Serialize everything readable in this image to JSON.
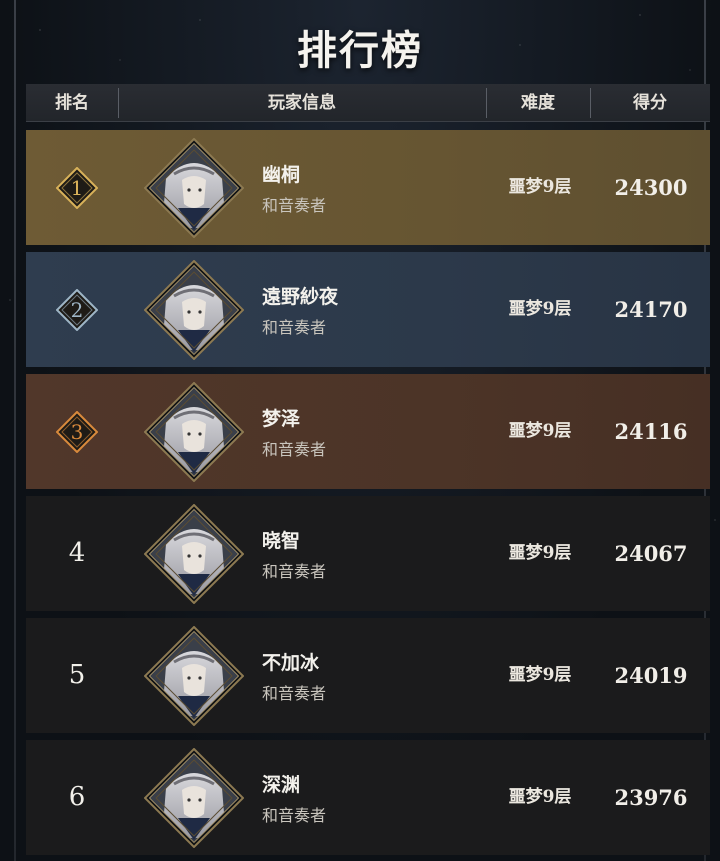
{
  "title": "排行榜",
  "columns": {
    "rank": "排名",
    "player": "玩家信息",
    "difficulty": "难度",
    "score": "得分"
  },
  "rows": [
    {
      "rank": "1",
      "tier": "gold",
      "name": "幽桐",
      "class": "和音奏者",
      "difficulty": "噩梦9层",
      "score": "24300"
    },
    {
      "rank": "2",
      "tier": "blue",
      "name": "遠野紗夜",
      "class": "和音奏者",
      "difficulty": "噩梦9层",
      "score": "24170"
    },
    {
      "rank": "3",
      "tier": "bronze",
      "name": "梦泽",
      "class": "和音奏者",
      "difficulty": "噩梦9层",
      "score": "24116"
    },
    {
      "rank": "4",
      "tier": "normal",
      "name": "晓智",
      "class": "和音奏者",
      "difficulty": "噩梦9层",
      "score": "24067"
    },
    {
      "rank": "5",
      "tier": "normal",
      "name": "不加冰",
      "class": "和音奏者",
      "difficulty": "噩梦9层",
      "score": "24019"
    },
    {
      "rank": "6",
      "tier": "normal",
      "name": "深渊",
      "class": "和音奏者",
      "difficulty": "噩梦9层",
      "score": "23976"
    }
  ],
  "colors": {
    "gold_badge": "#d9b25a",
    "blue_badge": "#9fb6c6",
    "bronze_badge": "#d98a3c"
  },
  "icons": {
    "avatar": "player-portrait-icon"
  }
}
